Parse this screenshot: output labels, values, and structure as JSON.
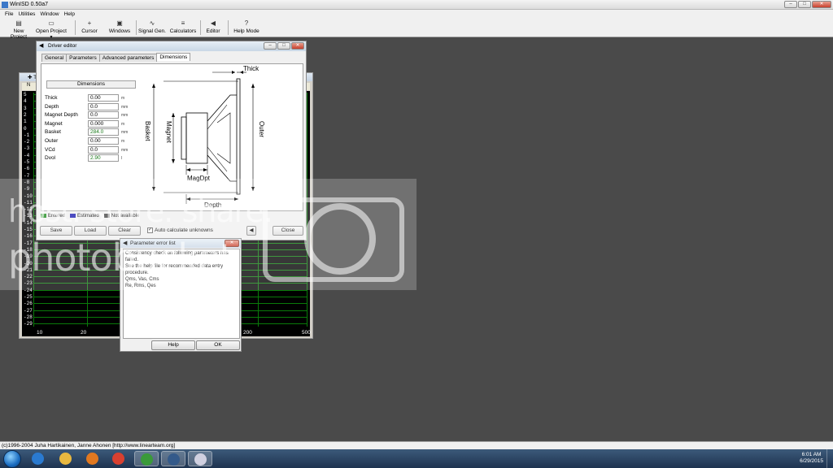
{
  "app": {
    "title": "WinISD 0.50a7",
    "window_buttons": [
      "–",
      "□",
      "✕"
    ]
  },
  "menu": [
    "File",
    "Utilities",
    "Window",
    "Help"
  ],
  "toolbar": [
    {
      "label": "New Project",
      "icon": "new-project-icon",
      "glyph": "▤"
    },
    {
      "label": "Open Project",
      "icon": "open-folder-icon",
      "glyph": "▭"
    },
    {
      "label": "Cursor",
      "icon": "crosshair-icon",
      "glyph": "+"
    },
    {
      "label": "Windows",
      "icon": "windows-icon",
      "glyph": "▣"
    },
    {
      "label": "Signal Gen.",
      "icon": "sine-wave-icon",
      "glyph": "∿"
    },
    {
      "label": "Calculators",
      "icon": "calculator-icon",
      "glyph": "≡"
    },
    {
      "label": "Editor",
      "icon": "speaker-icon",
      "glyph": "◀"
    },
    {
      "label": "Help Mode",
      "icon": "question-icon",
      "glyph": "?"
    }
  ],
  "graph": {
    "y_ticks": [
      "5",
      "4",
      "3",
      "2",
      "1",
      "0",
      "-1",
      "-2",
      "-3",
      "-4",
      "-5",
      "-6",
      "-7",
      "-8",
      "-9",
      "-10",
      "-11",
      "-12",
      "-13",
      "-14",
      "-15",
      "-16",
      "-17",
      "-18",
      "-19",
      "-20",
      "-21",
      "-22",
      "-23",
      "-24",
      "-25",
      "-26",
      "-27",
      "-28",
      "-29"
    ],
    "x_ticks": [
      "10",
      "20",
      "200",
      "500"
    ]
  },
  "driver_editor": {
    "title": "Driver editor",
    "tabs": [
      "General",
      "Parameters",
      "Advanced parameters",
      "Dimensions"
    ],
    "active_tab": "Dimensions",
    "section_header": "Dimensions",
    "fields": [
      {
        "label": "Thick",
        "value": "0.00",
        "unit": "m"
      },
      {
        "label": "Depth",
        "value": "0.0",
        "unit": "mm"
      },
      {
        "label": "Magnet Depth",
        "value": "0.0",
        "unit": "mm"
      },
      {
        "label": "Magnet",
        "value": "0.000",
        "unit": "m"
      },
      {
        "label": "Basket",
        "value": "284.0",
        "unit": "mm"
      },
      {
        "label": "Outer",
        "value": "0.00",
        "unit": "m"
      },
      {
        "label": "VCd",
        "value": "0.0",
        "unit": "mm"
      },
      {
        "label": "Dvol",
        "value": "2.90",
        "unit": "l"
      }
    ],
    "diagram": {
      "thick": "Thick",
      "basket": "Basket",
      "magnet": "Magnet",
      "outer": "Outer",
      "magdpt": "MagDpt",
      "depth": "Depth"
    },
    "legend": [
      {
        "label": "Entered",
        "color": "#1a8a1a"
      },
      {
        "label": "Estimated",
        "color": "#1a1ab0"
      },
      {
        "label": "Not available",
        "color": "#444444"
      }
    ],
    "buttons": {
      "save": "Save",
      "load": "Load",
      "clear": "Clear",
      "close": "Close"
    },
    "auto_calc_label": "Auto calculate unknowns",
    "auto_calc_checked": true
  },
  "error_list": {
    "title": "Parameter error list",
    "lines": [
      "Consistency check on following parameters has failed.",
      "See the help file for recommended data entry procedure.",
      "Qms, Vas, Cms",
      "Re, Rms, Qes"
    ],
    "help_button": "Help",
    "ok_button": "OK"
  },
  "watermark": {
    "line1": "host. store. share.",
    "line2": "photobucket"
  },
  "status_text": "(c)1996-2004 Juha Hartikainen, Janne Ahonen [http://www.linearteam.org]",
  "taskbar": {
    "apps": [
      {
        "name": "ie-icon",
        "color": "#2a7ad0"
      },
      {
        "name": "explorer-icon",
        "color": "#e8b840"
      },
      {
        "name": "media-player-icon",
        "color": "#e07820"
      },
      {
        "name": "chrome-icon",
        "color": "#d84030"
      },
      {
        "name": "globe-icon",
        "color": "#3a9a3a"
      },
      {
        "name": "winisd-icon",
        "color": "#345a8a"
      },
      {
        "name": "paint-icon",
        "color": "#d0d0e0"
      }
    ],
    "clock_time": "6:01 AM",
    "clock_date": "6/29/2015"
  }
}
